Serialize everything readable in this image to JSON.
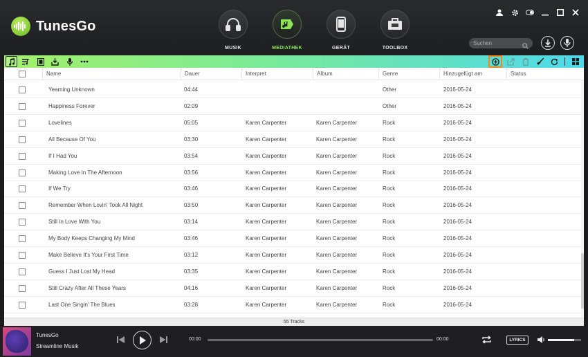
{
  "app": {
    "name": "TunesGo"
  },
  "nav": [
    {
      "id": "musik",
      "label": "MUSIK",
      "active": false
    },
    {
      "id": "mediathek",
      "label": "MEDIATHEK",
      "active": true
    },
    {
      "id": "geraet",
      "label": "GERÄT",
      "active": false
    },
    {
      "id": "toolbox",
      "label": "TOOLBOX",
      "active": false
    }
  ],
  "search": {
    "placeholder": "Suchen"
  },
  "table": {
    "headers": [
      "Name",
      "Dauer",
      "Interpret",
      "Album",
      "Genre",
      "Hinzugefügt am",
      "Status"
    ],
    "rows": [
      [
        "Yearning Unknown",
        "04:44",
        "",
        "",
        "Other",
        "2016-05-24",
        ""
      ],
      [
        "Happiness Forever",
        "02:09",
        "",
        "",
        "Other",
        "2016-05-24",
        ""
      ],
      [
        "Lovelines",
        "05:05",
        "Karen Carpenter",
        "Karen Carpenter",
        "Rock",
        "2016-05-24",
        ""
      ],
      [
        "All Because Of You",
        "03:30",
        "Karen Carpenter",
        "Karen Carpenter",
        "Rock",
        "2016-05-24",
        ""
      ],
      [
        "If I Had You",
        "03:54",
        "Karen Carpenter",
        "Karen Carpenter",
        "Rock",
        "2016-05-24",
        ""
      ],
      [
        "Making Love In The Afternoon",
        "03:56",
        "Karen Carpenter",
        "Karen Carpenter",
        "Rock",
        "2016-05-24",
        ""
      ],
      [
        "If We Try",
        "03:46",
        "Karen Carpenter",
        "Karen Carpenter",
        "Rock",
        "2016-05-24",
        ""
      ],
      [
        "Remember When Lovin' Took All Night",
        "03:50",
        "Karen Carpenter",
        "Karen Carpenter",
        "Rock",
        "2016-05-24",
        ""
      ],
      [
        "Still In Love With You",
        "03:14",
        "Karen Carpenter",
        "Karen Carpenter",
        "Rock",
        "2016-05-24",
        ""
      ],
      [
        "My Body Keeps Changing My Mind",
        "03:46",
        "Karen Carpenter",
        "Karen Carpenter",
        "Rock",
        "2016-05-24",
        ""
      ],
      [
        "Make Believe It's Your First Time",
        "03:12",
        "Karen Carpenter",
        "Karen Carpenter",
        "Rock",
        "2016-05-24",
        ""
      ],
      [
        "Guess I Just Lost My Head",
        "03:35",
        "Karen Carpenter",
        "Karen Carpenter",
        "Rock",
        "2016-05-24",
        ""
      ],
      [
        "Still Crazy After All These Years",
        "04:16",
        "Karen Carpenter",
        "Karen Carpenter",
        "Rock",
        "2016-05-24",
        ""
      ],
      [
        "Last One Singin' The Blues",
        "03:28",
        "Karen Carpenter",
        "Karen Carpenter",
        "Rock",
        "2016-05-24",
        ""
      ]
    ],
    "track_count": "55 Tracks"
  },
  "player": {
    "title": "TunesGo",
    "subtitle": "Streamline Musik",
    "time_current": "00:00",
    "time_total": "00:00",
    "progress": 0,
    "lyrics_label": "LYRICS",
    "volume": 0.8
  },
  "colors": {
    "accent": "#8fe356",
    "toolbar_start": "#a5f06a",
    "toolbar_end": "#4ed9ea",
    "highlight": "#f08a1c"
  }
}
